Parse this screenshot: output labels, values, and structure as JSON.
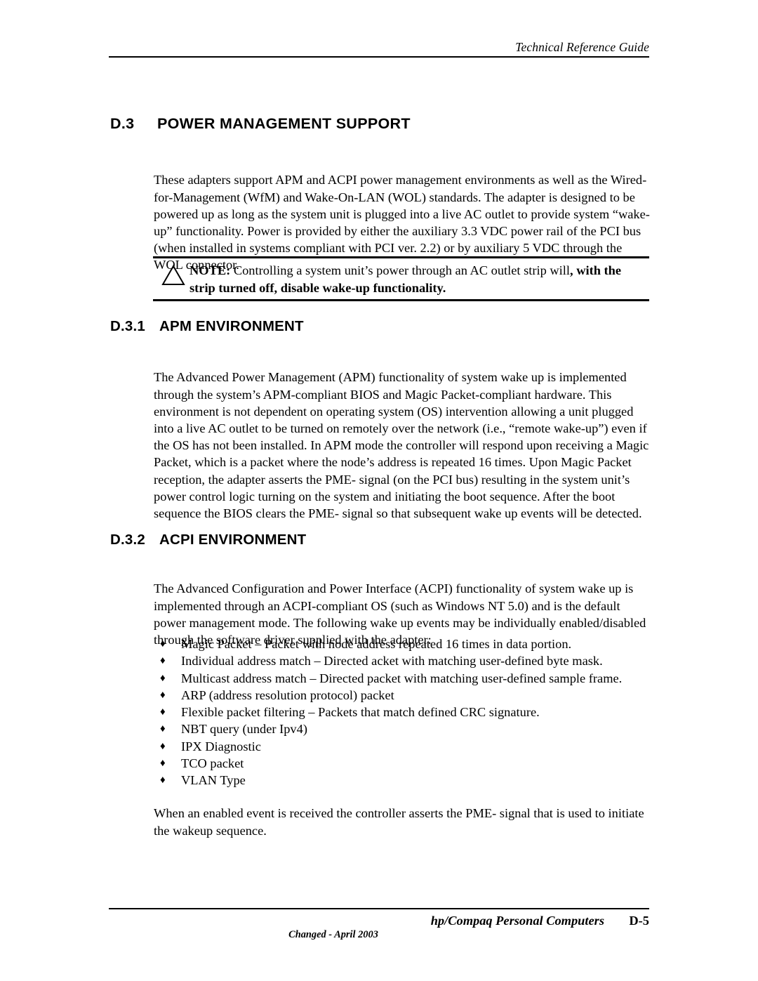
{
  "header": {
    "title": "Technical Reference Guide"
  },
  "sections": {
    "d3": {
      "number": "D.3",
      "title": "POWER MANAGEMENT SUPPORT",
      "intro": "These adapters support APM and ACPI power management environments as well as the Wired-for-Management (WfM) and Wake-On-LAN (WOL) standards. The adapter is designed to be powered up as long as the system unit is plugged into a live AC outlet to provide system “wake-up” functionality. Power is provided by either the auxiliary 3.3 VDC power rail of the PCI bus (when installed in systems compliant with PCI ver. 2.2) or by auxiliary 5 VDC through the WOL connector."
    },
    "note": {
      "icon": "warning-triangle",
      "label": "NOTE:",
      "text_regular": " Controlling a system unit’s power through an AC outlet strip will",
      "text_bold": ", with the strip turned off, disable wake-up functionality."
    },
    "d31": {
      "number": "D.3.1",
      "title": "APM ENVIRONMENT",
      "body": "The Advanced Power Management (APM) functionality of system wake up is implemented through the system’s APM-compliant BIOS and Magic Packet-compliant hardware. This environment is not dependent on operating system (OS) intervention allowing a unit plugged into a live AC outlet to be turned on remotely over the network (i.e., “remote wake-up”) even if the OS has not been installed. In APM mode the controller will respond upon receiving a Magic Packet, which is a packet where the node’s address is repeated 16 times. Upon Magic Packet reception, the adapter asserts the PME- signal (on the PCI bus) resulting in the system unit’s power control logic turning on the system and initiating the boot sequence.  After the boot sequence the BIOS clears the PME- signal so that subsequent wake up events will be detected."
    },
    "d32": {
      "number": "D.3.2",
      "title": "ACPI ENVIRONMENT",
      "body": "The Advanced Configuration and Power Interface (ACPI) functionality of system wake up is implemented through an ACPI-compliant OS (such as Windows NT 5.0) and is the default power management mode. The following wake up events may be individually enabled/disabled through the software driver supplied with the adapter:",
      "bullet_glyph": "♦",
      "bullets": [
        "Magic Packet – Packet with node address repeated 16 times in data portion.",
        "Individual address match – Directed acket with matching user-defined byte mask.",
        "Multicast address match – Directed packet with matching user-defined sample frame.",
        "ARP (address resolution protocol) packet",
        "Flexible packet filtering – Packets that match defined CRC signature.",
        "NBT query (under Ipv4)",
        "IPX Diagnostic",
        "TCO packet",
        "VLAN Type"
      ],
      "closing": "When an enabled event is received the controller asserts the PME- signal that is used to initiate the wakeup sequence."
    }
  },
  "footer": {
    "brand": "hp/Compaq Personal Computers",
    "page_number": "D-5",
    "changed": "Changed - April 2003"
  }
}
